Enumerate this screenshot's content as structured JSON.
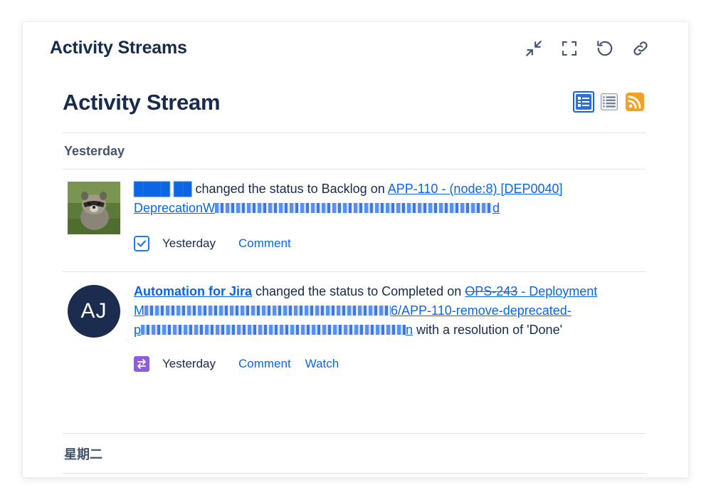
{
  "card": {
    "title": "Activity Streams",
    "actions": [
      {
        "icon": "minimize-icon"
      },
      {
        "icon": "fullscreen-icon"
      },
      {
        "icon": "refresh-icon"
      },
      {
        "icon": "link-icon"
      }
    ]
  },
  "stream": {
    "title": "Activity Stream",
    "view_icons": [
      {
        "icon": "full-view-icon",
        "active": true
      },
      {
        "icon": "list-view-icon",
        "active": false
      },
      {
        "icon": "rss-feed-icon",
        "active": false
      }
    ],
    "groups": [
      {
        "label": "Yesterday",
        "items": [
          {
            "actor_redacted": "████ ██",
            "verb": " changed the status to Backlog on ",
            "issue_part1": "APP-110 - (node:8) [DEP0040]",
            "issue_part2": "DeprecationW",
            "timestamp": "Yesterday",
            "actions": [
              "Comment"
            ],
            "type_icon": "task-checkbox-icon"
          },
          {
            "actor": "Automation for Jira",
            "avatar_initials": "AJ",
            "verb": " changed the status to Completed on ",
            "issue_key": "OPS-243",
            "issue_part1": " - Deployment",
            "issue_part2": "M",
            "issue_part3": "6/APP-110-remove-deprecated-",
            "issue_part4": "p",
            "issue_part5": "n",
            "resolution": " with a resolution of 'Done'",
            "timestamp": "Yesterday",
            "actions": [
              "Comment",
              "Watch"
            ],
            "type_icon": "transition-icon"
          }
        ]
      },
      {
        "label": "星期二",
        "items": []
      }
    ]
  },
  "colors": {
    "link": "#0c66e4",
    "text": "#172b4d",
    "avatar_bg": "#1b2c4e",
    "transition_icon_bg": "#8f5cdc",
    "task_icon": "#1d7afc",
    "rss": "#f3a123"
  }
}
